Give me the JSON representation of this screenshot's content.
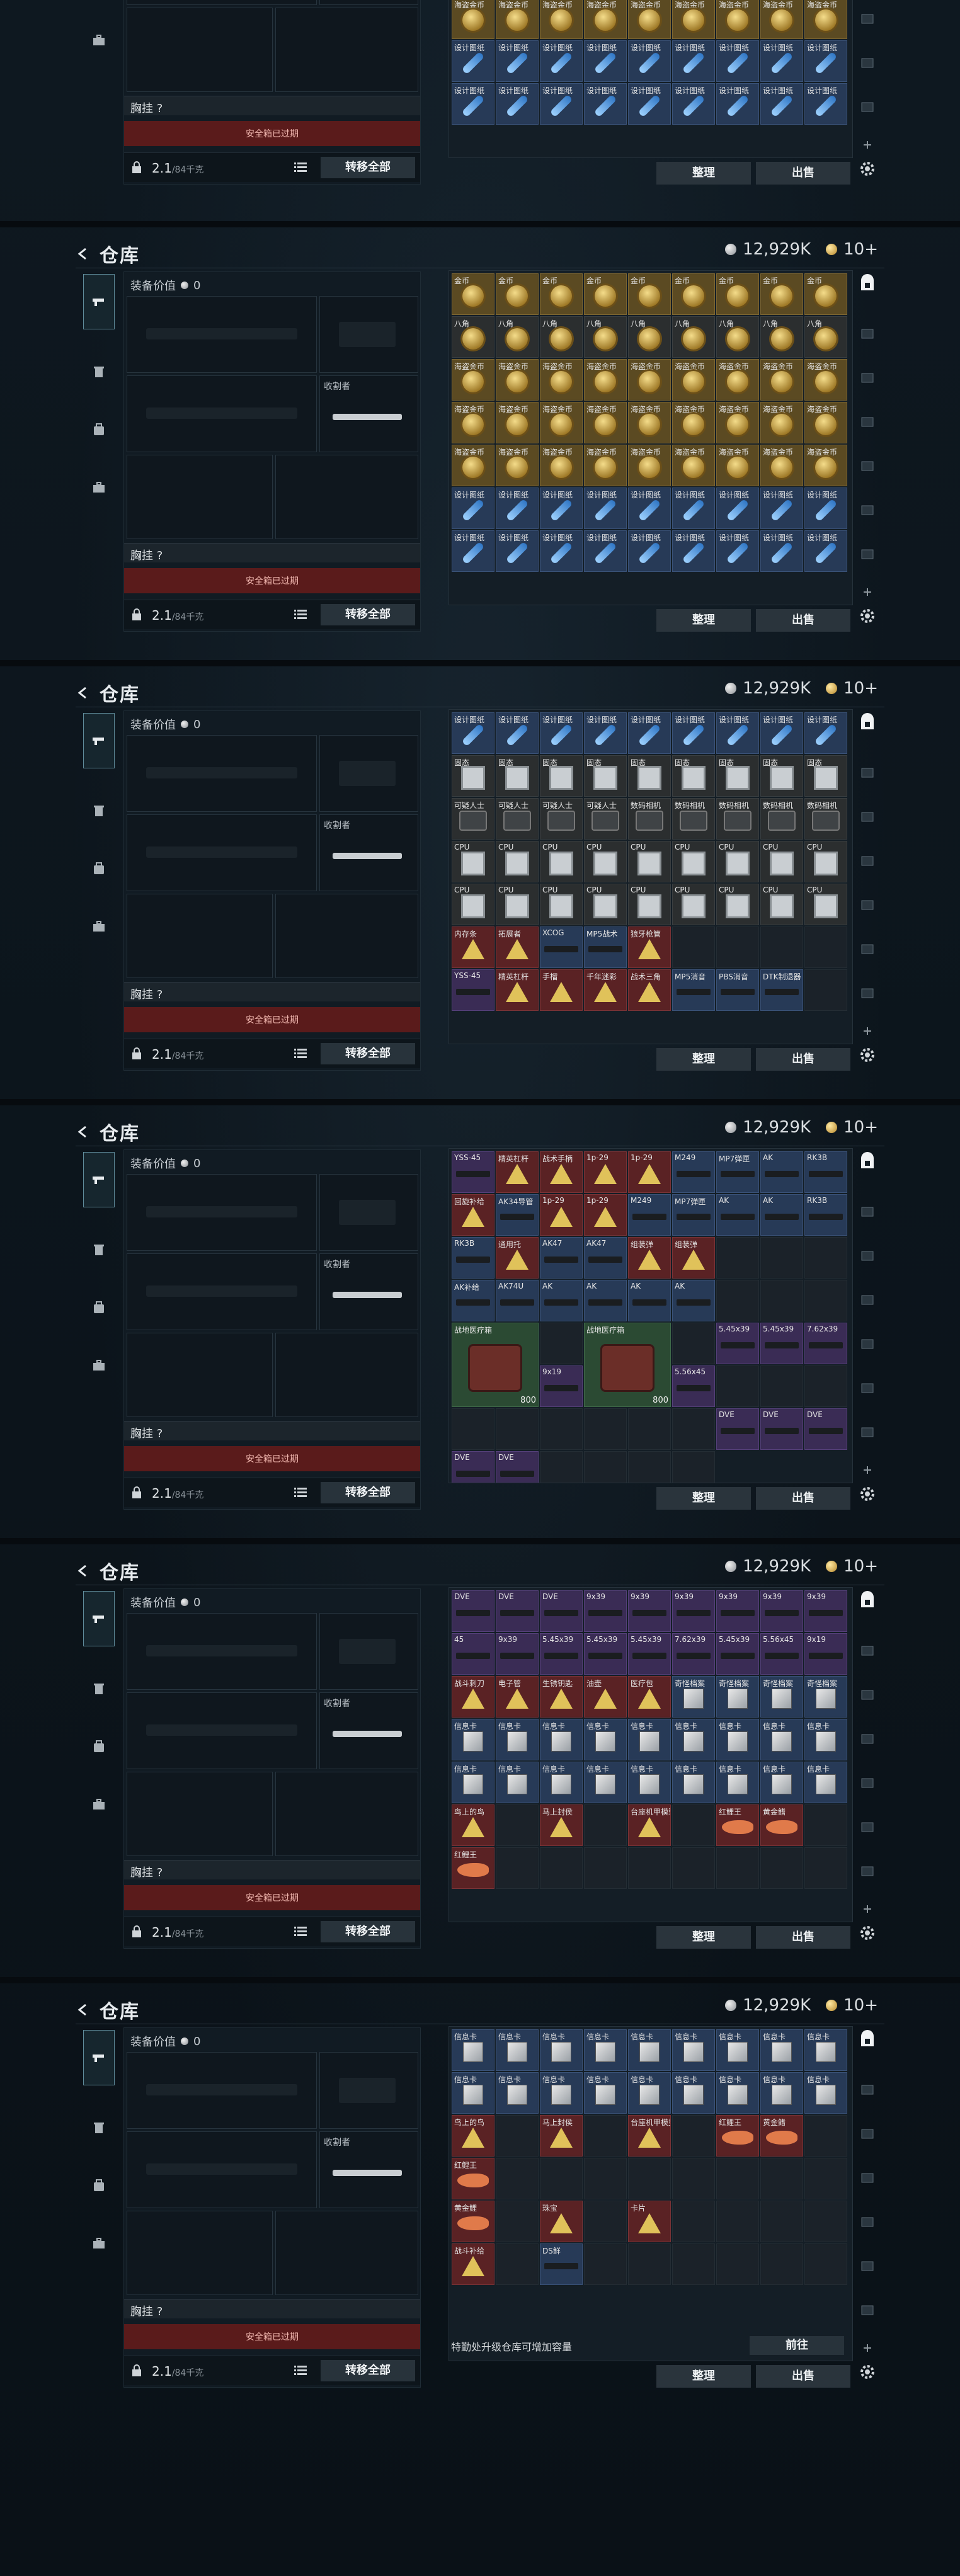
{
  "header": {
    "title": "仓库",
    "silver": "12,929K",
    "gold": "10+"
  },
  "equipment": {
    "value_label": "装备价值",
    "value": "0",
    "knife_label": "收割者",
    "chest_label": "胸挂 ?",
    "warn": "安全箱已过期",
    "weight": "2.1",
    "weight_unit": "/84千克",
    "transfer_label": "转移全部"
  },
  "buttons": {
    "sort": "整理",
    "sell": "出售"
  },
  "footer_hint": {
    "text": "特勤处升级仓库可增加容量",
    "goto": "前往"
  },
  "grids": [
    [
      "金币",
      "金币",
      "金币",
      "金币",
      "金币",
      "金币",
      "金币",
      "金币",
      "金币",
      "八角",
      "八角",
      "八角",
      "八角",
      "八角",
      "八角",
      "八角",
      "八角",
      "八角",
      "海盗金币",
      "海盗金币",
      "海盗金币",
      "海盗金币",
      "海盗金币",
      "海盗金币",
      "海盗金币",
      "海盗金币",
      "海盗金币",
      "海盗金币",
      "海盗金币",
      "海盗金币",
      "海盗金币",
      "海盗金币",
      "海盗金币",
      "海盗金币",
      "海盗金币",
      "海盗金币",
      "海盗金币",
      "海盗金币",
      "海盗金币",
      "海盗金币",
      "海盗金币",
      "海盗金币",
      "海盗金币",
      "海盗金币",
      "海盗金币",
      "设计图纸",
      "设计图纸",
      "设计图纸",
      "设计图纸",
      "设计图纸",
      "设计图纸",
      "设计图纸",
      "设计图纸",
      "设计图纸",
      "设计图纸",
      "设计图纸",
      "设计图纸",
      "设计图纸",
      "设计图纸",
      "设计图纸",
      "设计图纸",
      "设计图纸",
      "设计图纸"
    ],
    [
      "设计图纸",
      "设计图纸",
      "设计图纸",
      "设计图纸",
      "设计图纸",
      "设计图纸",
      "设计图纸",
      "设计图纸",
      "设计图纸",
      "固态",
      "固态",
      "固态",
      "固态",
      "固态",
      "固态",
      "固态",
      "固态",
      "固态",
      "可疑人士",
      "可疑人士",
      "可疑人士",
      "可疑人士",
      "数码相机",
      "数码相机",
      "数码相机",
      "数码相机",
      "数码相机",
      "CPU",
      "CPU",
      "CPU",
      "CPU",
      "CPU",
      "CPU",
      "CPU",
      "CPU",
      "CPU",
      "CPU",
      "CPU",
      "CPU",
      "CPU",
      "CPU",
      "CPU",
      "CPU",
      "CPU",
      "CPU",
      "内存条",
      "拓展者",
      "XCOG",
      "MP5战术",
      "狼牙枪管",
      "",
      "",
      "",
      "",
      "YSS-45",
      "精英杠杆",
      "手榴",
      "千年迷彩",
      "战术三角",
      "MP5消音",
      "PBS消音",
      "DTK制退器",
      ""
    ],
    [
      "YSS-45",
      "精英杠杆",
      "战术手柄",
      "1p-29",
      "1p-29",
      "M249",
      "MP7弹匣",
      "AK",
      "RK3B",
      "回旋补给",
      "AK34导管",
      "1p-29",
      "1p-29",
      "M249",
      "MP7弹匣",
      "AK",
      "AK",
      "RK3B",
      "RK3B",
      "通用托",
      "AK47",
      "AK47",
      "组装弹",
      "组装弹",
      "",
      "",
      "",
      "AK补给",
      "AK74U",
      "AK",
      "AK",
      "AK",
      "AK",
      "",
      "",
      "",
      "战地医疗箱",
      "",
      "战地医疗箱",
      "",
      "5.45x39",
      "5.45x39",
      "7.62x39",
      "9x19",
      "5.56x45",
      "",
      "",
      "",
      "",
      "",
      "",
      "",
      "",
      "",
      "DVE",
      "DVE",
      "DVE",
      "DVE",
      "DVE",
      "",
      "",
      "",
      ""
    ],
    [
      "DVE",
      "DVE",
      "DVE",
      "9x39",
      "9x39",
      "9x39",
      "9x39",
      "9x39",
      "9x39",
      "45",
      "9x39",
      "5.45x39",
      "5.45x39",
      "5.45x39",
      "7.62x39",
      "5.45x39",
      "5.56x45",
      "9x19",
      "战斗刺刀",
      "电子管",
      "生锈钥匙",
      "油壶",
      "医疗包",
      "奇怪档案",
      "奇怪档案",
      "奇怪档案",
      "奇怪档案",
      "信息卡",
      "信息卡",
      "信息卡",
      "信息卡",
      "信息卡",
      "信息卡",
      "信息卡",
      "信息卡",
      "信息卡",
      "信息卡",
      "信息卡",
      "信息卡",
      "信息卡",
      "信息卡",
      "信息卡",
      "信息卡",
      "信息卡",
      "信息卡",
      "鸟上的鸟",
      "",
      "马上封侯",
      "",
      "台座机甲模型",
      "",
      "红鲤王",
      "黄金鳍",
      "",
      "红鲤王",
      "",
      "",
      "",
      "",
      "",
      "",
      "",
      ""
    ],
    [
      "信息卡",
      "信息卡",
      "信息卡",
      "信息卡",
      "信息卡",
      "信息卡",
      "信息卡",
      "信息卡",
      "信息卡",
      "信息卡",
      "信息卡",
      "信息卡",
      "信息卡",
      "信息卡",
      "信息卡",
      "信息卡",
      "信息卡",
      "信息卡",
      "鸟上的鸟",
      "",
      "马上封侯",
      "",
      "台座机甲模型",
      "",
      "红鲤王",
      "黄金鳍",
      "",
      "红鲤王",
      "",
      "",
      "",
      "",
      "",
      "",
      "",
      "",
      "黄金鲤",
      "",
      "珠宝",
      "",
      "卡片",
      "",
      "",
      "",
      "",
      "战斗补给",
      "",
      "DS鲜",
      "",
      "",
      "",
      "",
      "",
      ""
    ]
  ],
  "quantities": {
    "medkit_1": "800",
    "medkit_2": "800"
  }
}
